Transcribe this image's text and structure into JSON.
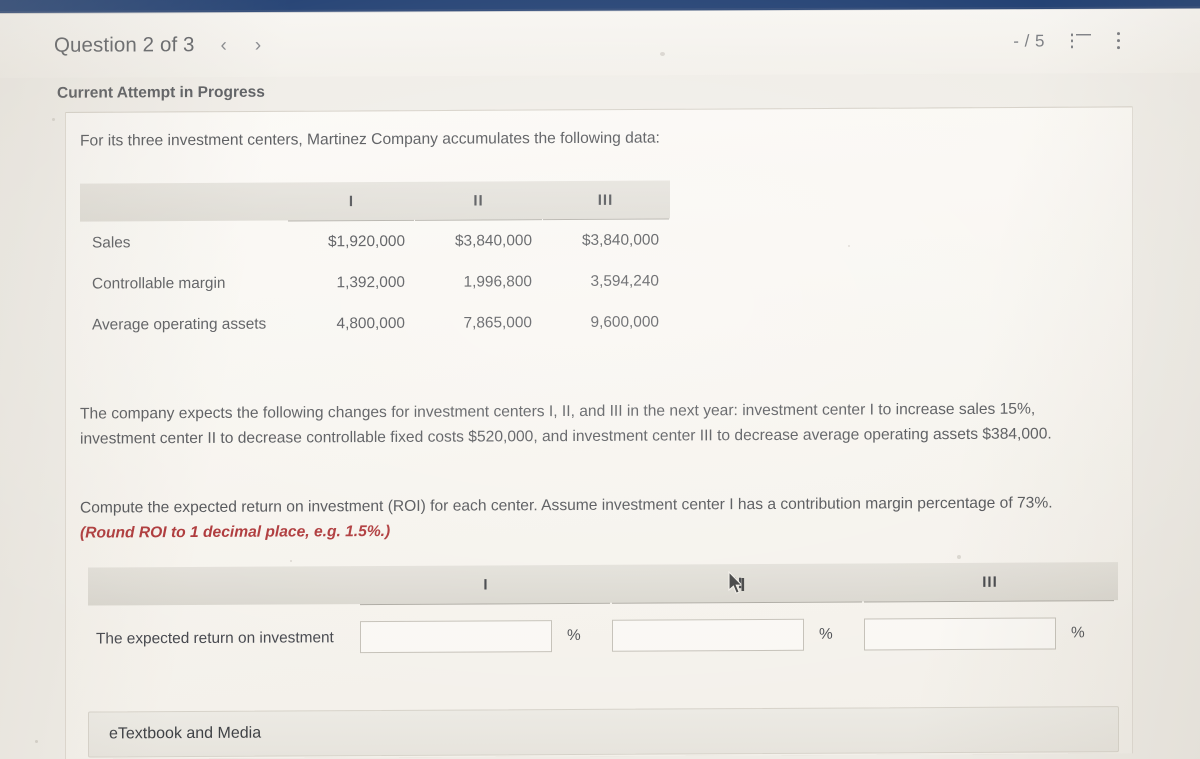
{
  "header": {
    "question_label": "Question 2 of 3",
    "prev_icon": "chevron-left-icon",
    "next_icon": "chevron-right-icon",
    "prev_glyph": "‹",
    "next_glyph": "›",
    "score": "- / 5",
    "list_icon": "list-view-icon",
    "menu_icon": "kebab-menu-icon",
    "navy_bar_color": "#1b3a6e"
  },
  "attempt": {
    "status": "Current Attempt in Progress"
  },
  "question": {
    "intro": "For its three investment centers, Martinez Company accumulates the following data:",
    "paragraph_1": "The company expects the following changes for investment centers I, II, and III in the next year: investment center I to increase sales 15%, investment center II to decrease controllable fixed costs $520,000, and investment center III to decrease average operating assets $384,000.",
    "paragraph_2_main": "Compute the expected return on investment (ROI) for each center. Assume investment center I has a contribution margin percentage of 73%. ",
    "paragraph_2_note": "(Round ROI to 1 decimal place, e.g. 1.5%.)",
    "note_color": "#a8292b"
  },
  "data_table": {
    "row_header_blank": "",
    "columns": [
      "I",
      "II",
      "III"
    ],
    "rows": [
      {
        "label": "Sales",
        "values": [
          "$1,920,000",
          "$3,840,000",
          "$3,840,000"
        ]
      },
      {
        "label": "Controllable margin",
        "values": [
          "1,392,000",
          "1,996,800",
          "3,594,240"
        ]
      },
      {
        "label": "Average operating assets",
        "values": [
          "4,800,000",
          "7,865,000",
          "9,600,000"
        ]
      }
    ]
  },
  "answer_table": {
    "columns": [
      "I",
      "II",
      "III"
    ],
    "row_label": "The expected return on investment",
    "inputs": [
      {
        "value": "",
        "placeholder": "",
        "suffix": "%"
      },
      {
        "value": "",
        "placeholder": "",
        "suffix": "%"
      },
      {
        "value": "",
        "placeholder": "",
        "suffix": "%"
      }
    ]
  },
  "footer": {
    "etextbook_label": "eTextbook and Media"
  }
}
